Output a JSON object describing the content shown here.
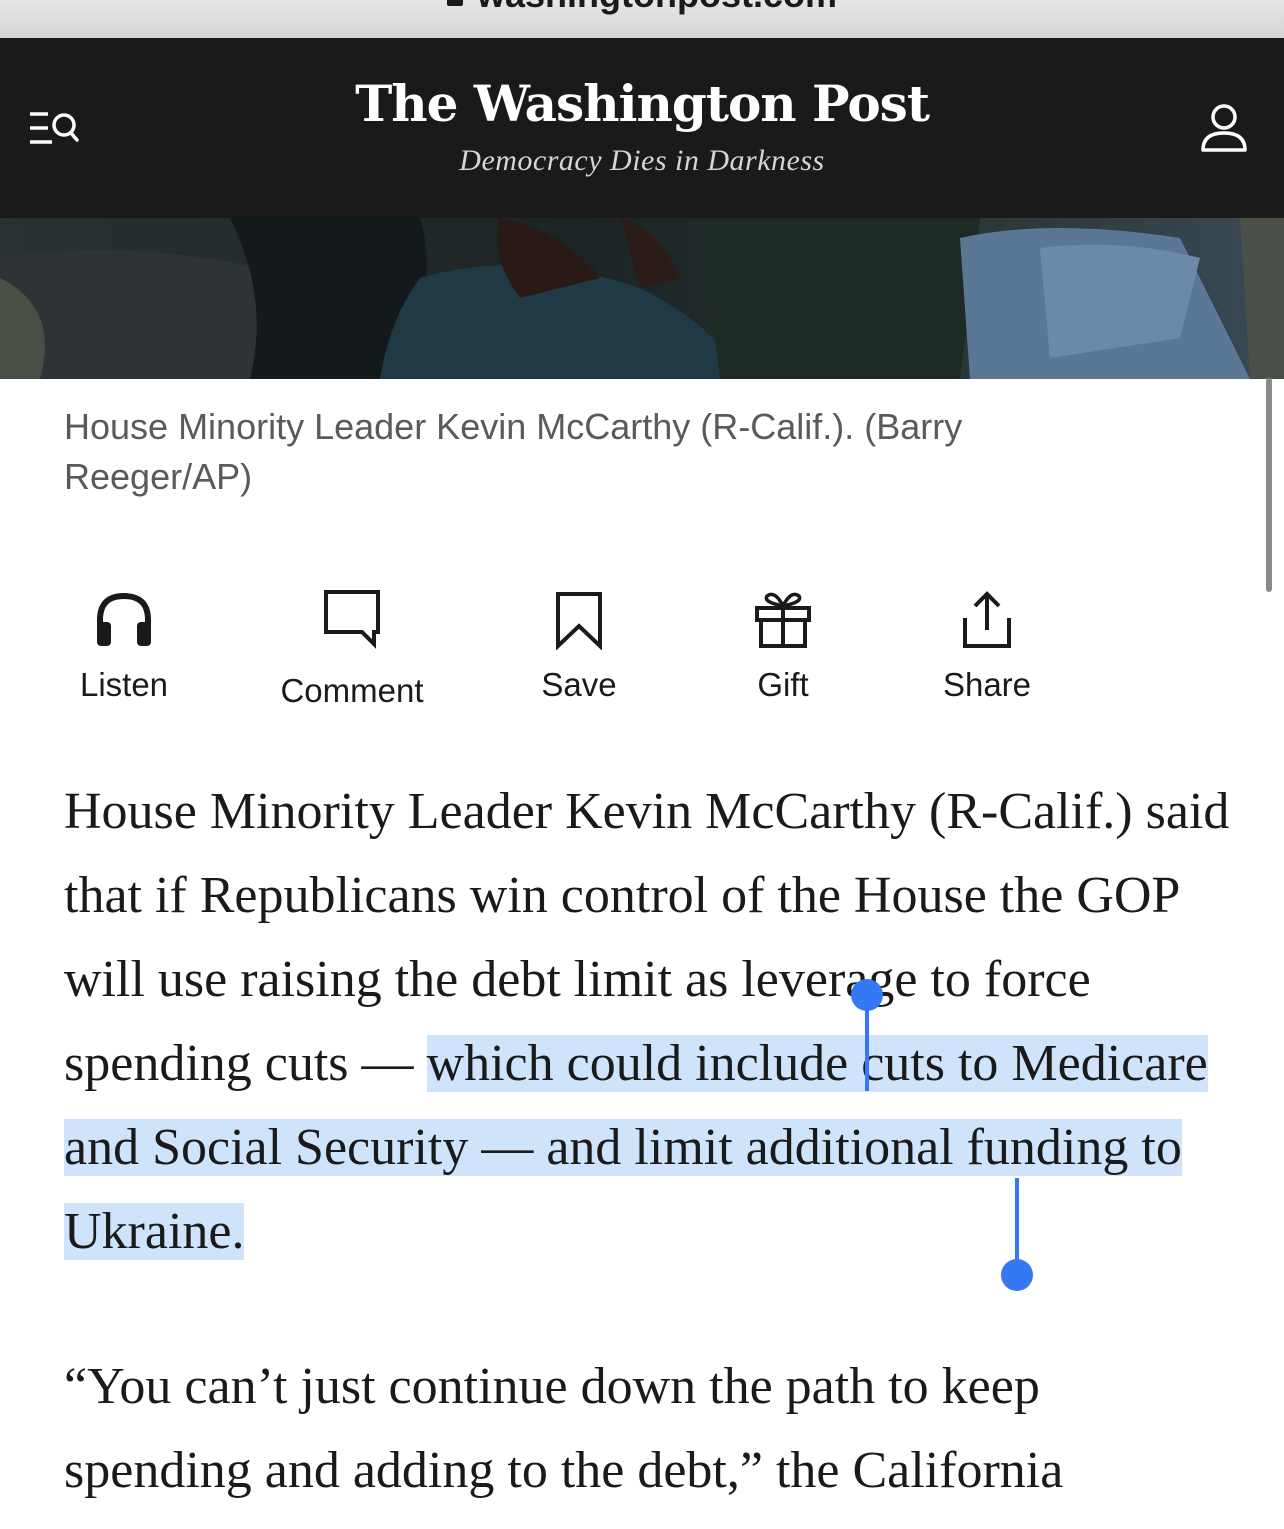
{
  "browser": {
    "url": "washingtonpost.com"
  },
  "header": {
    "logo": "The Washington Post",
    "tagline": "Democracy Dies in Darkness",
    "menu_icon": "menu-search-icon",
    "account_icon": "account-icon"
  },
  "photo": {
    "caption": "House Minority Leader Kevin McCarthy (R-Calif.). (Barry Reeger/AP)"
  },
  "actions": [
    {
      "label": "Listen",
      "icon": "headphones-icon"
    },
    {
      "label": "Comment",
      "icon": "comment-icon"
    },
    {
      "label": "Save",
      "icon": "bookmark-icon"
    },
    {
      "label": "Gift",
      "icon": "gift-icon"
    },
    {
      "label": "Share",
      "icon": "share-icon"
    }
  ],
  "article": {
    "paragraph1_part1": "House Minority Leader Kevin McCarthy (R-Calif.) said that if Republicans win control of the House the GOP will use raising the debt limit as leverage to force spending cuts — ",
    "paragraph1_selected": "which could include cuts to Medicare and Social Security — and limit additional funding to Ukraine.",
    "paragraph2": "“You can’t just continue down the path to keep spending and adding to the debt,” the California"
  },
  "colors": {
    "header_bg": "#1a1a1a",
    "selection": "#cfe3fb",
    "selection_handle": "#3478f6"
  }
}
